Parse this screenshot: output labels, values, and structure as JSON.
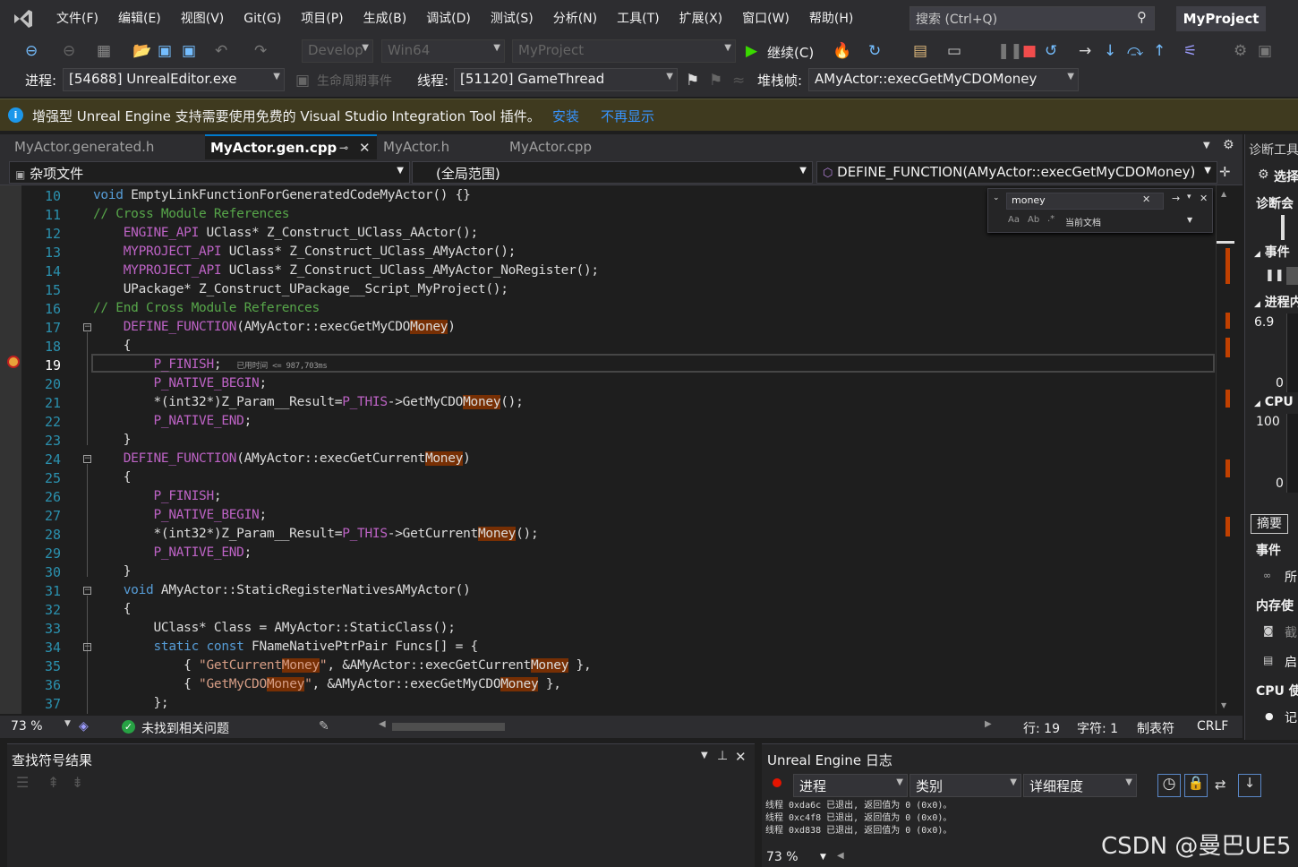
{
  "menu": {
    "items": [
      "文件(F)",
      "编辑(E)",
      "视图(V)",
      "Git(G)",
      "项目(P)",
      "生成(B)",
      "调试(D)",
      "测试(S)",
      "分析(N)",
      "工具(T)",
      "扩展(X)",
      "窗口(W)",
      "帮助(H)"
    ],
    "search_placeholder": "搜索 (Ctrl+Q)",
    "project_name": "MyProject"
  },
  "toolbar": {
    "config": "Develop",
    "platform": "Win64",
    "startup": "MyProject",
    "continue_label": "继续(C)",
    "process_label": "进程:",
    "process_value": "[54688] UnrealEditor.exe",
    "lifecycle_label": "生命周期事件",
    "thread_label": "线程:",
    "thread_value": "[51120] GameThread",
    "stack_label": "堆栈帧:",
    "stack_value": "AMyActor::execGetMyCDOMoney"
  },
  "infobar": {
    "message": "增强型 Unreal Engine 支持需要使用免费的 Visual Studio Integration Tool 插件。",
    "install": "安装",
    "dont_show": "不再显示"
  },
  "tabs": [
    {
      "label": "MyActor.generated.h",
      "active": false
    },
    {
      "label": "MyActor.gen.cpp",
      "active": true
    },
    {
      "label": "MyActor.h",
      "active": false
    },
    {
      "label": "MyActor.cpp",
      "active": false
    }
  ],
  "nav": {
    "project": "杂项文件",
    "scope": "(全局范围)",
    "member": "DEFINE_FUNCTION(AMyActor::execGetMyCDOMoney)"
  },
  "find": {
    "query": "money",
    "scope": "当前文档"
  },
  "code_lines": [
    {
      "n": "10",
      "html": "<span class=\"kw\">void</span> EmptyLinkFunctionForGeneratedCodeMyActor() {}"
    },
    {
      "n": "11",
      "html": "<span class=\"cm\">// Cross Module References</span>"
    },
    {
      "n": "12",
      "html": "    <span class=\"mc\">ENGINE_API</span> UClass* Z_Construct_UClass_AActor();"
    },
    {
      "n": "13",
      "html": "    <span class=\"mc\">MYPROJECT_API</span> UClass* Z_Construct_UClass_AMyActor();"
    },
    {
      "n": "14",
      "html": "    <span class=\"mc\">MYPROJECT_API</span> UClass* Z_Construct_UClass_AMyActor_NoRegister();"
    },
    {
      "n": "15",
      "html": "    UPackage* Z_Construct_UPackage__Script_MyProject();"
    },
    {
      "n": "16",
      "html": "<span class=\"cm\">// End Cross Module References</span>"
    },
    {
      "n": "17",
      "html": "    <span class=\"mc\">DEFINE_FUNCTION</span>(AMyActor::execGetMyCDO<span class=\"hl\">Money</span>)"
    },
    {
      "n": "18",
      "html": "    {"
    },
    {
      "n": "19",
      "html": "        <span class=\"mc\">P_FINISH</span>;  <span style=\"font-size:9px;color:#999\">已用时间 &lt;= 987,703ms</span>"
    },
    {
      "n": "20",
      "html": "        <span class=\"mc\">P_NATIVE_BEGIN</span>;"
    },
    {
      "n": "21",
      "html": "        *(int32*)Z_Param__Result=<span class=\"mc\">P_THIS</span>-&gt;GetMyCDO<span class=\"hl\">Money</span>();"
    },
    {
      "n": "22",
      "html": "        <span class=\"mc\">P_NATIVE_END</span>;"
    },
    {
      "n": "23",
      "html": "    }"
    },
    {
      "n": "24",
      "html": "    <span class=\"mc\">DEFINE_FUNCTION</span>(AMyActor::execGetCurrent<span class=\"hl\">Money</span>)"
    },
    {
      "n": "25",
      "html": "    {"
    },
    {
      "n": "26",
      "html": "        <span class=\"mc\">P_FINISH</span>;"
    },
    {
      "n": "27",
      "html": "        <span class=\"mc\">P_NATIVE_BEGIN</span>;"
    },
    {
      "n": "28",
      "html": "        *(int32*)Z_Param__Result=<span class=\"mc\">P_THIS</span>-&gt;GetCurrent<span class=\"hl\">Money</span>();"
    },
    {
      "n": "29",
      "html": "        <span class=\"mc\">P_NATIVE_END</span>;"
    },
    {
      "n": "30",
      "html": "    }"
    },
    {
      "n": "31",
      "html": "    <span class=\"kw\">void</span> AMyActor::StaticRegisterNativesAMyActor()"
    },
    {
      "n": "32",
      "html": "    {"
    },
    {
      "n": "33",
      "html": "        UClass* Class = AMyActor::StaticClass();"
    },
    {
      "n": "34",
      "html": "        <span class=\"kw\">static const</span> FNameNativePtrPair Funcs[] = {"
    },
    {
      "n": "35",
      "html": "            { <span class=\"st\">\"GetCurrent<span class=\"hl\">Money</span>\"</span>, &amp;AMyActor::execGetCurrent<span class=\"hl\">Money</span> },"
    },
    {
      "n": "36",
      "html": "            { <span class=\"st\">\"GetMyCDO<span class=\"hl\">Money</span>\"</span>, &amp;AMyActor::execGetMyCDO<span class=\"hl\">Money</span> },"
    },
    {
      "n": "37",
      "html": "        };"
    }
  ],
  "status": {
    "zoom": "73 %",
    "issues": "未找到相关问题",
    "line": "行: 19",
    "char": "字符: 1",
    "tabs": "制表符",
    "eol": "CRLF"
  },
  "find_symbol": {
    "title": "查找符号结果"
  },
  "ue_log": {
    "title": "Unreal Engine 日志",
    "process": "进程",
    "category": "类别",
    "verbosity": "详细程度",
    "lines": [
      "线程 0xda6c 已退出, 返回值为 0 (0x0)。",
      "线程 0xc4f8 已退出, 返回值为 0 (0x0)。",
      "线程 0xd838 已退出, 返回值为 0 (0x0)。"
    ],
    "zoom": "73 %"
  },
  "diagnostics": {
    "title": "诊断工具",
    "select": "选择",
    "session": "诊断会",
    "events": "事件",
    "process_mem": "进程内",
    "mem_top": "6.9",
    "mem_bottom": "0",
    "cpu": "CPU",
    "cpu_top": "100",
    "cpu_bottom": "0",
    "summary_tab": "摘要",
    "events2": "事件",
    "all": "所",
    "mem_usage": "内存使",
    "snapshot": "截",
    "enable": "启",
    "cpu_usage": "CPU 使",
    "record": "记"
  },
  "watermark": "CSDN @曼巴UE5",
  "colors": {
    "accent": "#007acc",
    "background": "#1e1e1e",
    "chrome": "#2d2d30",
    "find_highlight": "#772f04"
  }
}
